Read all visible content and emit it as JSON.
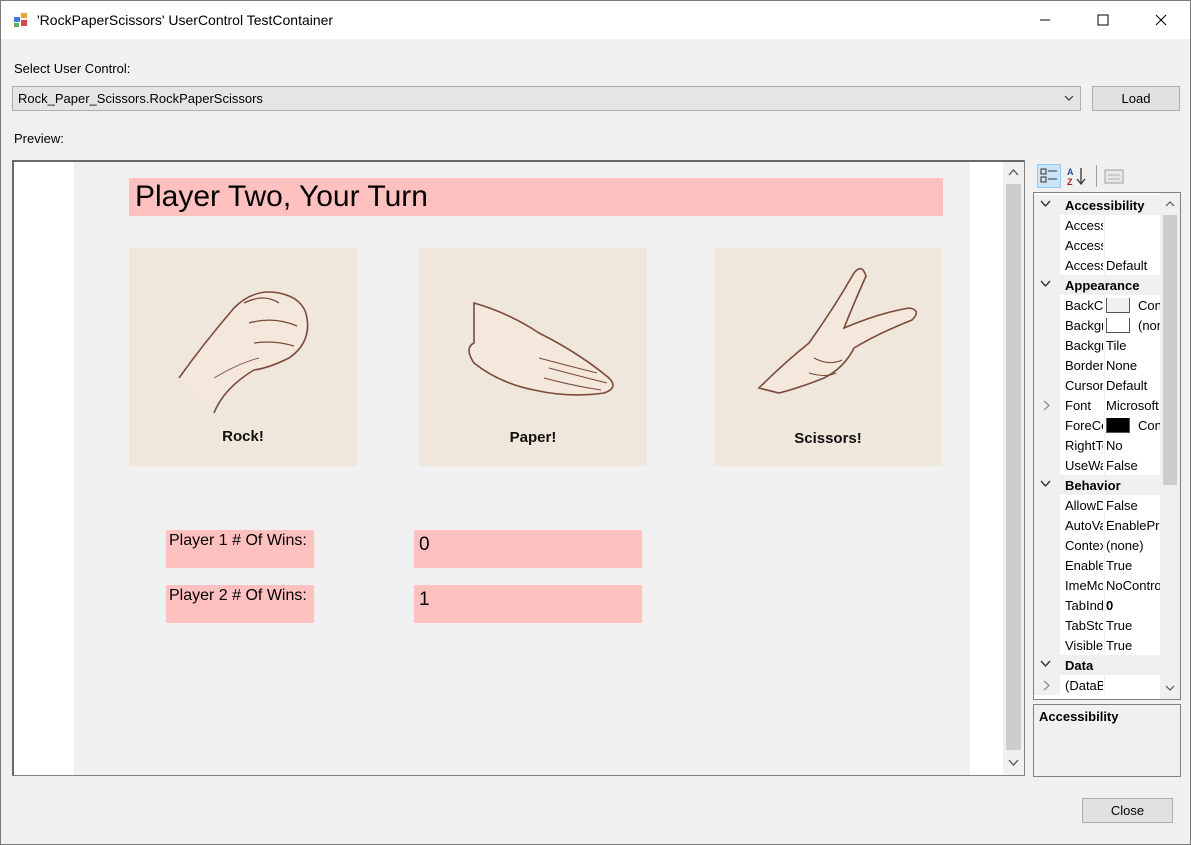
{
  "window": {
    "title": "'RockPaperScissors' UserControl TestContainer"
  },
  "select": {
    "label": "Select User Control:",
    "value": "Rock_Paper_Scissors.RockPaperScissors",
    "load_label": "Load"
  },
  "preview": {
    "label": "Preview:",
    "turn_text": "Player Two, Your Turn",
    "cards": [
      {
        "caption": "Rock!"
      },
      {
        "caption": "Paper!"
      },
      {
        "caption": "Scissors!"
      }
    ],
    "p1_label": "Player 1 # Of Wins:",
    "p1_wins": "0",
    "p2_label": "Player 2 # Of Wins:",
    "p2_wins": "1"
  },
  "properties": {
    "rows": [
      {
        "kind": "cat",
        "name": "Accessibility"
      },
      {
        "kind": "prop",
        "name": "AccessibleDescription",
        "value": ""
      },
      {
        "kind": "prop",
        "name": "AccessibleName",
        "value": ""
      },
      {
        "kind": "prop",
        "name": "AccessibleRole",
        "value": "Default"
      },
      {
        "kind": "cat",
        "name": "Appearance"
      },
      {
        "kind": "prop",
        "name": "BackColor",
        "value": "Control",
        "swatch": "#f0f0f0"
      },
      {
        "kind": "prop",
        "name": "BackgroundImage",
        "value": "(none)",
        "swatch": "#ffffff"
      },
      {
        "kind": "prop",
        "name": "BackgroundImageLayout",
        "value": "Tile"
      },
      {
        "kind": "prop",
        "name": "BorderStyle",
        "value": "None"
      },
      {
        "kind": "prop",
        "name": "Cursor",
        "value": "Default"
      },
      {
        "kind": "prop",
        "name": "Font",
        "value": "Microsoft Sans Serif",
        "expand": true
      },
      {
        "kind": "prop",
        "name": "ForeColor",
        "value": "ControlText",
        "swatch": "#000000"
      },
      {
        "kind": "prop",
        "name": "RightToLeft",
        "value": "No"
      },
      {
        "kind": "prop",
        "name": "UseWaitCursor",
        "value": "False"
      },
      {
        "kind": "cat",
        "name": "Behavior"
      },
      {
        "kind": "prop",
        "name": "AllowDrop",
        "value": "False"
      },
      {
        "kind": "prop",
        "name": "AutoValidate",
        "value": "EnablePreventFocusChange"
      },
      {
        "kind": "prop",
        "name": "ContextMenuStrip",
        "value": "(none)"
      },
      {
        "kind": "prop",
        "name": "Enabled",
        "value": "True"
      },
      {
        "kind": "prop",
        "name": "ImeMode",
        "value": "NoControl"
      },
      {
        "kind": "prop",
        "name": "TabIndex",
        "value": "0",
        "bold": true
      },
      {
        "kind": "prop",
        "name": "TabStop",
        "value": "True"
      },
      {
        "kind": "prop",
        "name": "Visible",
        "value": "True"
      },
      {
        "kind": "cat",
        "name": "Data"
      },
      {
        "kind": "prop",
        "name": "(DataBindings)",
        "value": "",
        "expand": true
      }
    ],
    "description_title": "Accessibility"
  },
  "footer": {
    "close_label": "Close"
  }
}
